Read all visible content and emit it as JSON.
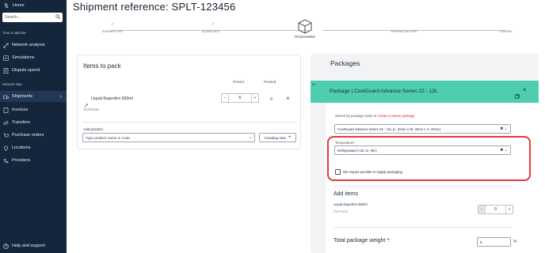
{
  "sidebar": {
    "home_label": "Home",
    "search_placeholder": "Search...",
    "section_tune": "Tune & optimise",
    "section_network": "Network data",
    "items": [
      {
        "label": "Network analysis",
        "icon": "network-icon"
      },
      {
        "label": "Simulations",
        "icon": "simulation-icon"
      },
      {
        "label": "Dispute spend",
        "icon": "dispute-icon"
      },
      {
        "label": "Shipments",
        "icon": "shipments-icon",
        "active": true
      },
      {
        "label": "Invoices",
        "icon": "invoice-icon"
      },
      {
        "label": "Transfers",
        "icon": "transfer-icon"
      },
      {
        "label": "Purchase orders",
        "icon": "purchase-order-icon"
      },
      {
        "label": "Locations",
        "icon": "location-icon"
      },
      {
        "label": "Providers",
        "icon": "providers-icon"
      }
    ],
    "help_label": "Help and support"
  },
  "page": {
    "title": "Shipment reference: SPLT-123456"
  },
  "stepper": {
    "steps": [
      {
        "label": "SHIPMENT REF",
        "done": true
      },
      {
        "label": "ADDRESSES",
        "done": true
      },
      {
        "label": "PACKAGING",
        "active": true
      },
      {
        "label": "SHIPPING METHOD"
      },
      {
        "label": "CONFIRM"
      }
    ]
  },
  "items_to_pack": {
    "title": "Items to pack",
    "col_picked": "Picked",
    "col_packed": "Packed",
    "item": {
      "name": "Liquid Ibuprofen 500ml",
      "sku": "PLIP1234",
      "picked": "6",
      "packed": "0"
    },
    "add_product_label": "Add product",
    "add_product_placeholder": "Type product name or code",
    "create_new_label": "Creating new"
  },
  "packages": {
    "title": "Packages",
    "package_no": "#1",
    "package_title": "Package | CoolGuard Advance Series 22 - 12L",
    "search_hint_prefix": "Search by package name or",
    "search_hint_link": "create a custom package",
    "package_selected": "CoolGuard Advance Series 22 - 12L (L: 20cm x W: 20cm x H: 20cm)",
    "temperature_label": "Temperature*",
    "temperature_value": "Refrigerated (+2C to +8C)",
    "supply_packaging_label": "We require provider to supply packaging",
    "add_items_title": "Add items",
    "add_item": {
      "name": "Liquid Ibuprofen 500ml",
      "sku": "PLIP1234",
      "qty": "0"
    },
    "weight_label": "Total package weight *:",
    "weight_value": "5",
    "weight_unit": "kg"
  },
  "colors": {
    "sidebar_bg": "#14253c",
    "accent_teal": "#4ecdb0",
    "highlight_red": "#e03a3a",
    "link_red": "#d3262c"
  }
}
